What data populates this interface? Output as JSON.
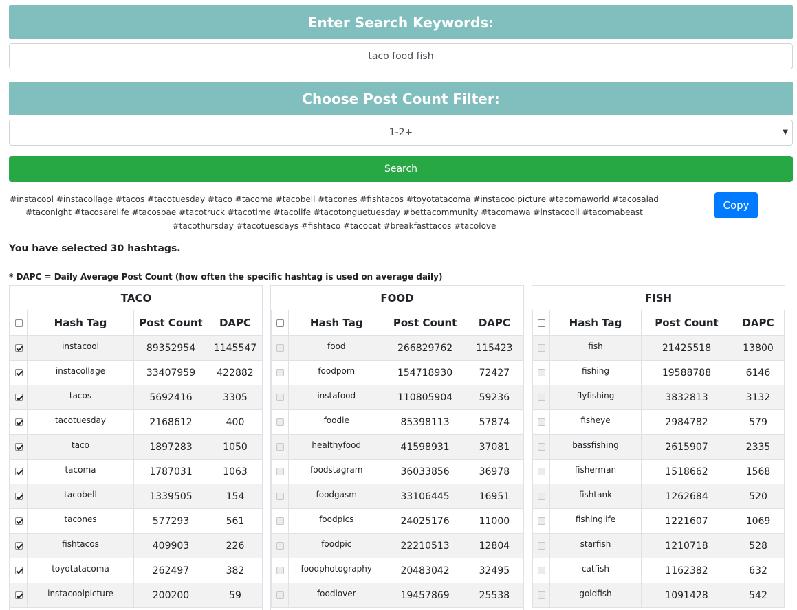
{
  "search": {
    "keywords_heading": "Enter Search Keywords:",
    "keywords_value": "taco food fish",
    "filter_heading": "Choose Post Count Filter:",
    "filter_selected": "1-2+",
    "search_button": "Search"
  },
  "result": {
    "hashtags_text": "#instacool #instacollage #tacos #tacotuesday #taco #tacoma #tacobell #tacones #fishtacos #toyotatacoma #instacoolpicture #tacomaworld #tacosalad #taconight #tacosarelife #tacosbae #tacotruck #tacotime #tacolife #tacotonguetuesday #bettacommunity #tacomawa #instacooll #tacomabeast #tacothursday #tacotuesdays #fishtaco #tacocat #breakfasttacos #tacolove",
    "copy_button": "Copy",
    "selected_message": "You have selected 30 hashtags.",
    "dapc_note": "* DAPC = Daily Average Post Count (how often the specific hashtag is used on average daily)"
  },
  "columns": {
    "hash_tag": "Hash Tag",
    "post_count": "Post Count",
    "dapc": "DAPC"
  },
  "tables": [
    {
      "title": "TACO",
      "rows": [
        {
          "tag": "instacool",
          "post_count": "89352954",
          "dapc": "1145547",
          "checked": true
        },
        {
          "tag": "instacollage",
          "post_count": "33407959",
          "dapc": "422882",
          "checked": true
        },
        {
          "tag": "tacos",
          "post_count": "5692416",
          "dapc": "3305",
          "checked": true
        },
        {
          "tag": "tacotuesday",
          "post_count": "2168612",
          "dapc": "400",
          "checked": true
        },
        {
          "tag": "taco",
          "post_count": "1897283",
          "dapc": "1050",
          "checked": true
        },
        {
          "tag": "tacoma",
          "post_count": "1787031",
          "dapc": "1063",
          "checked": true
        },
        {
          "tag": "tacobell",
          "post_count": "1339505",
          "dapc": "154",
          "checked": true
        },
        {
          "tag": "tacones",
          "post_count": "577293",
          "dapc": "561",
          "checked": true
        },
        {
          "tag": "fishtacos",
          "post_count": "409903",
          "dapc": "226",
          "checked": true
        },
        {
          "tag": "toyotatacoma",
          "post_count": "262497",
          "dapc": "382",
          "checked": true
        },
        {
          "tag": "instacoolpicture",
          "post_count": "200200",
          "dapc": "59",
          "checked": true
        }
      ]
    },
    {
      "title": "FOOD",
      "rows": [
        {
          "tag": "food",
          "post_count": "266829762",
          "dapc": "115423",
          "checked": false
        },
        {
          "tag": "foodporn",
          "post_count": "154718930",
          "dapc": "72427",
          "checked": false
        },
        {
          "tag": "instafood",
          "post_count": "110805904",
          "dapc": "59236",
          "checked": false
        },
        {
          "tag": "foodie",
          "post_count": "85398113",
          "dapc": "57874",
          "checked": false
        },
        {
          "tag": "healthyfood",
          "post_count": "41598931",
          "dapc": "37081",
          "checked": false
        },
        {
          "tag": "foodstagram",
          "post_count": "36033856",
          "dapc": "36978",
          "checked": false
        },
        {
          "tag": "foodgasm",
          "post_count": "33106445",
          "dapc": "16951",
          "checked": false
        },
        {
          "tag": "foodpics",
          "post_count": "24025176",
          "dapc": "11000",
          "checked": false
        },
        {
          "tag": "foodpic",
          "post_count": "22210513",
          "dapc": "12804",
          "checked": false
        },
        {
          "tag": "foodphotography",
          "post_count": "20483042",
          "dapc": "32495",
          "checked": false
        },
        {
          "tag": "foodlover",
          "post_count": "19457869",
          "dapc": "25538",
          "checked": false
        }
      ]
    },
    {
      "title": "FISH",
      "rows": [
        {
          "tag": "fish",
          "post_count": "21425518",
          "dapc": "13800",
          "checked": false
        },
        {
          "tag": "fishing",
          "post_count": "19588788",
          "dapc": "6146",
          "checked": false
        },
        {
          "tag": "flyfishing",
          "post_count": "3832813",
          "dapc": "3132",
          "checked": false
        },
        {
          "tag": "fisheye",
          "post_count": "2984782",
          "dapc": "579",
          "checked": false
        },
        {
          "tag": "bassfishing",
          "post_count": "2615907",
          "dapc": "2335",
          "checked": false
        },
        {
          "tag": "fisherman",
          "post_count": "1518662",
          "dapc": "1568",
          "checked": false
        },
        {
          "tag": "fishtank",
          "post_count": "1262684",
          "dapc": "520",
          "checked": false
        },
        {
          "tag": "fishinglife",
          "post_count": "1221607",
          "dapc": "1069",
          "checked": false
        },
        {
          "tag": "starfish",
          "post_count": "1210718",
          "dapc": "528",
          "checked": false
        },
        {
          "tag": "catfish",
          "post_count": "1162382",
          "dapc": "632",
          "checked": false
        },
        {
          "tag": "goldfish",
          "post_count": "1091428",
          "dapc": "542",
          "checked": false
        }
      ]
    }
  ],
  "colors": {
    "banner": "#80bfbd",
    "search_button": "#28a745",
    "copy_button": "#007bff"
  }
}
